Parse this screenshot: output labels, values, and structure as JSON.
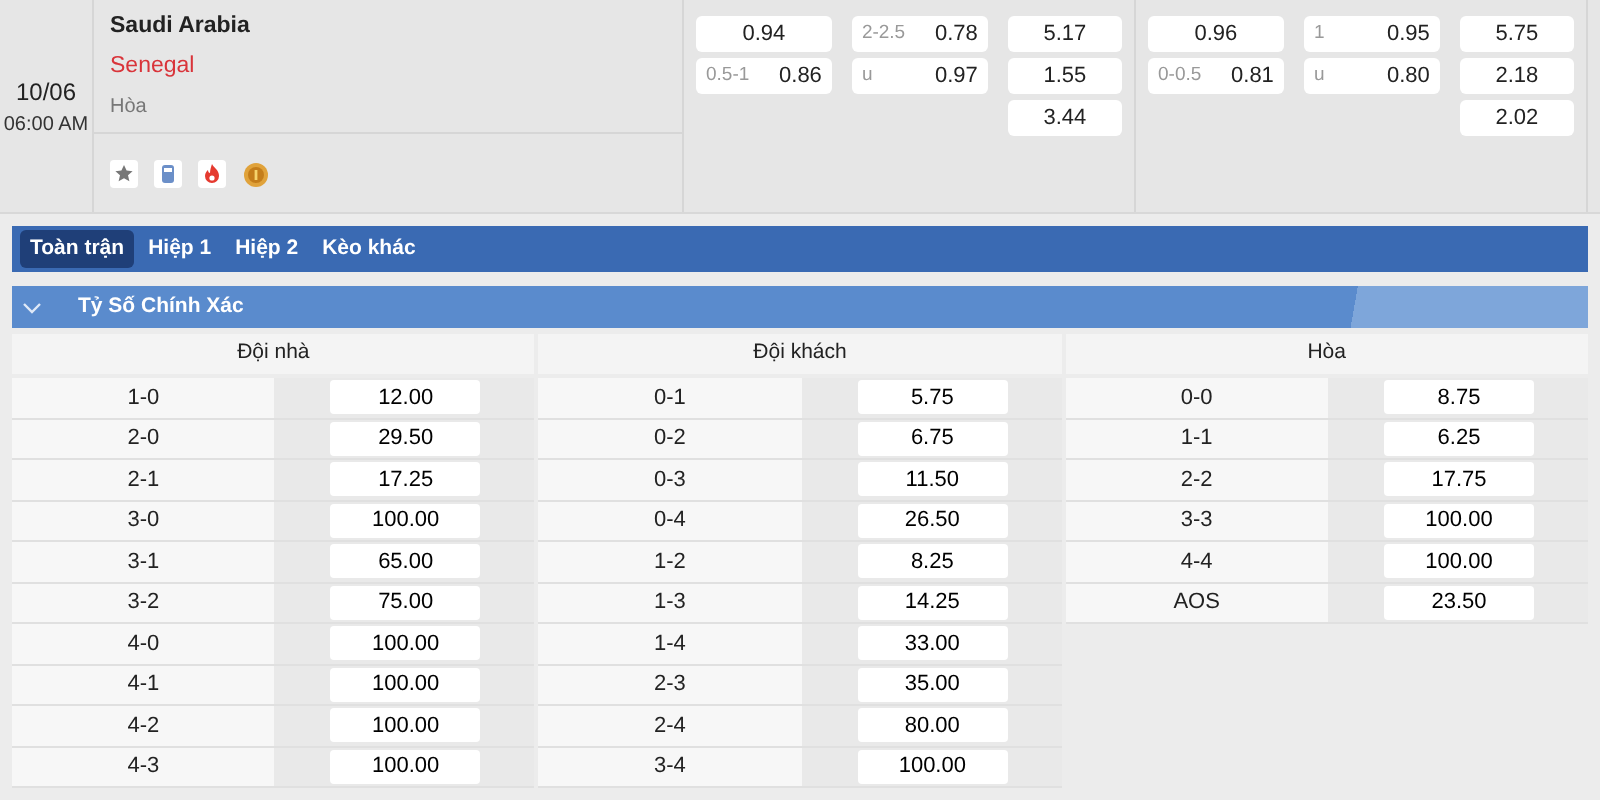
{
  "match": {
    "date": "10/06",
    "time": "06:00 AM",
    "home": "Saudi Arabia",
    "away": "Senegal",
    "draw": "Hòa"
  },
  "odds_groups": [
    {
      "columns": [
        [
          {
            "value": "0.94"
          },
          {
            "label": "0.5-1",
            "value": "0.86"
          }
        ],
        [
          {
            "label": "2-2.5",
            "value": "0.78"
          },
          {
            "label": "u",
            "value": "0.97"
          }
        ],
        [
          {
            "value": "5.17"
          },
          {
            "value": "1.55"
          },
          {
            "value": "3.44"
          }
        ]
      ]
    },
    {
      "columns": [
        [
          {
            "value": "0.96"
          },
          {
            "label": "0-0.5",
            "value": "0.81"
          }
        ],
        [
          {
            "label": "1",
            "value": "0.95"
          },
          {
            "label": "u",
            "value": "0.80"
          }
        ],
        [
          {
            "value": "5.75"
          },
          {
            "value": "2.18"
          },
          {
            "value": "2.02"
          }
        ]
      ]
    }
  ],
  "tabs": [
    {
      "label": "Toàn trận",
      "selected": true
    },
    {
      "label": "Hiệp 1",
      "selected": false
    },
    {
      "label": "Hiệp 2",
      "selected": false
    },
    {
      "label": "Kèo khác",
      "selected": false
    }
  ],
  "section": {
    "title": "Tỷ Số Chính Xác",
    "expanded": true
  },
  "score_columns": [
    {
      "header": "Đội nhà",
      "rows": [
        {
          "score": "1-0",
          "odds": "12.00"
        },
        {
          "score": "2-0",
          "odds": "29.50"
        },
        {
          "score": "2-1",
          "odds": "17.25"
        },
        {
          "score": "3-0",
          "odds": "100.00"
        },
        {
          "score": "3-1",
          "odds": "65.00"
        },
        {
          "score": "3-2",
          "odds": "75.00"
        },
        {
          "score": "4-0",
          "odds": "100.00"
        },
        {
          "score": "4-1",
          "odds": "100.00"
        },
        {
          "score": "4-2",
          "odds": "100.00"
        },
        {
          "score": "4-3",
          "odds": "100.00"
        }
      ]
    },
    {
      "header": "Đội khách",
      "rows": [
        {
          "score": "0-1",
          "odds": "5.75"
        },
        {
          "score": "0-2",
          "odds": "6.75"
        },
        {
          "score": "0-3",
          "odds": "11.50"
        },
        {
          "score": "0-4",
          "odds": "26.50"
        },
        {
          "score": "1-2",
          "odds": "8.25"
        },
        {
          "score": "1-3",
          "odds": "14.25"
        },
        {
          "score": "1-4",
          "odds": "33.00"
        },
        {
          "score": "2-3",
          "odds": "35.00"
        },
        {
          "score": "2-4",
          "odds": "80.00"
        },
        {
          "score": "3-4",
          "odds": "100.00"
        }
      ]
    },
    {
      "header": "Hòa",
      "rows": [
        {
          "score": "0-0",
          "odds": "8.75"
        },
        {
          "score": "1-1",
          "odds": "6.25"
        },
        {
          "score": "2-2",
          "odds": "17.75"
        },
        {
          "score": "3-3",
          "odds": "100.00"
        },
        {
          "score": "4-4",
          "odds": "100.00"
        },
        {
          "score": "AOS",
          "odds": "23.50"
        }
      ]
    }
  ]
}
